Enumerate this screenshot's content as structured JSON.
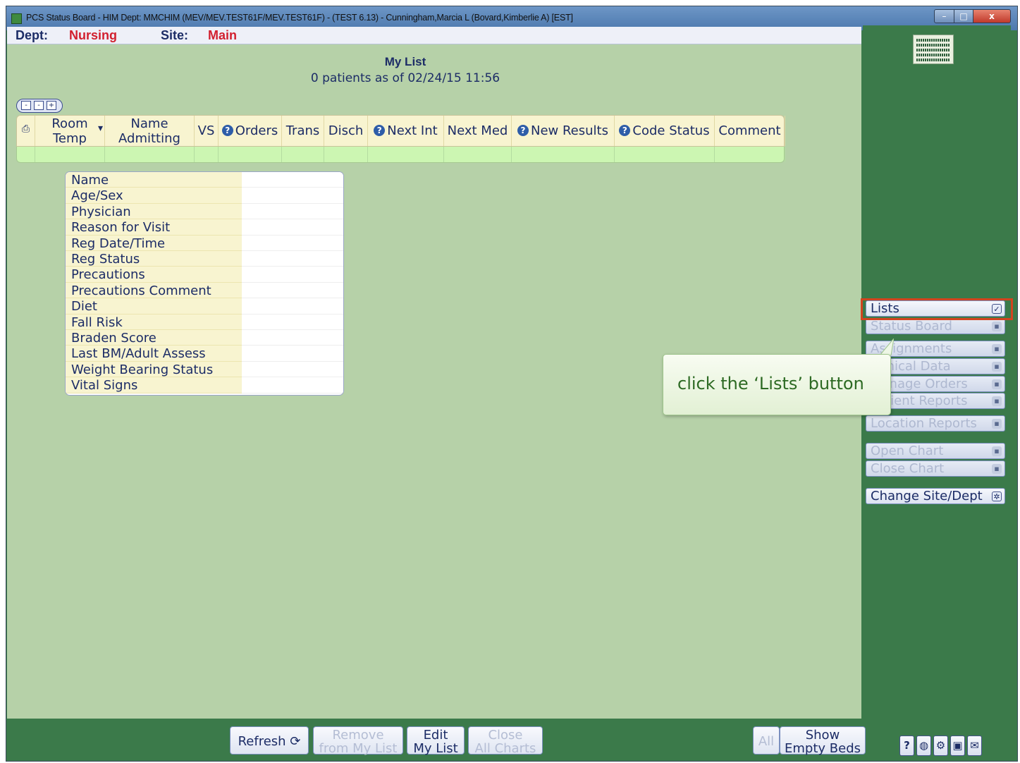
{
  "window": {
    "title": "PCS Status Board - HIM Dept: MMCHIM (MEV/MEV.TEST61F/MEV.TEST61F) - (TEST 6.13) - Cunningham,Marcia L (Bovard,Kimberlie A) [EST]",
    "controls": {
      "minimize": "–",
      "maximize": "□",
      "close": "x"
    }
  },
  "deptbar": {
    "dept_label": "Dept:",
    "dept_value": "Nursing",
    "site_label": "Site:",
    "site_value": "Main"
  },
  "list": {
    "title": "My List",
    "count_text": "0 patients as of 02/24/15 11:56"
  },
  "column_toggle": {
    "collapse": "-",
    "expand": "+"
  },
  "columns": [
    {
      "key": "room",
      "line1": "Room",
      "line2": "Temp",
      "help": false
    },
    {
      "key": "name",
      "line1": "Name",
      "line2": "Admitting",
      "help": false
    },
    {
      "key": "vs",
      "label": "VS",
      "help": false
    },
    {
      "key": "orders",
      "label": "Orders",
      "help": true
    },
    {
      "key": "trans",
      "label": "Trans",
      "help": false
    },
    {
      "key": "disch",
      "label": "Disch",
      "help": false
    },
    {
      "key": "next_int",
      "label": "Next Int",
      "help": true
    },
    {
      "key": "next_med",
      "label": "Next Med",
      "help": false
    },
    {
      "key": "new_results",
      "label": "New Results",
      "help": true
    },
    {
      "key": "code_status",
      "label": "Code Status",
      "help": true
    },
    {
      "key": "comment",
      "label": "Comment",
      "help": false
    }
  ],
  "detail_fields": [
    {
      "label": "Name",
      "value": ""
    },
    {
      "label": "Age/Sex",
      "value": ""
    },
    {
      "label": "Physician",
      "value": ""
    },
    {
      "label": "Reason for Visit",
      "value": ""
    },
    {
      "label": "Reg Date/Time",
      "value": ""
    },
    {
      "label": "Reg Status",
      "value": ""
    },
    {
      "label": "Precautions",
      "value": ""
    },
    {
      "label": "Precautions Comment",
      "value": ""
    },
    {
      "label": "Diet",
      "value": ""
    },
    {
      "label": "Fall Risk",
      "value": ""
    },
    {
      "label": "Braden Score",
      "value": ""
    },
    {
      "label": "Last BM/Adult Assess",
      "value": ""
    },
    {
      "label": "Weight Bearing Status",
      "value": ""
    },
    {
      "label": "Vital Signs",
      "value": ""
    }
  ],
  "sidebar": {
    "buttons": [
      {
        "label": "Lists",
        "enabled": true,
        "icon": "checklist-icon"
      },
      {
        "label": "Status Board",
        "enabled": false,
        "icon": "board-icon"
      },
      {
        "label": "Assignments",
        "enabled": false,
        "icon": "pencil-icon"
      },
      {
        "label": "Clinical Data",
        "enabled": false,
        "icon": "data-icon"
      },
      {
        "label": "Manage Orders",
        "enabled": false,
        "icon": "orders-icon"
      },
      {
        "label": "Patient Reports",
        "enabled": false,
        "icon": "report-icon"
      },
      {
        "label": "Location Reports",
        "enabled": false,
        "icon": "location-icon"
      },
      {
        "label": "Open Chart",
        "enabled": false,
        "icon": "open-chart-icon"
      },
      {
        "label": "Close Chart",
        "enabled": false,
        "icon": "close-chart-icon"
      },
      {
        "label": "Change Site/Dept",
        "enabled": true,
        "icon": "gear-icon"
      }
    ]
  },
  "callout": {
    "text": "click the ‘Lists’ button"
  },
  "bottombar": {
    "refresh": "Refresh",
    "remove_line1": "Remove",
    "remove_line2": "from My List",
    "edit_line1": "Edit",
    "edit_line2": "My List",
    "close_line1": "Close",
    "close_line2": "All Charts",
    "all": "All",
    "show_line1": "Show",
    "show_line2": "Empty Beds"
  },
  "tray_icons": [
    "help-icon",
    "globe-icon",
    "settings-icon",
    "lock-icon",
    "mail-icon"
  ],
  "colors": {
    "panel_green": "#b6d1a8",
    "frame_green": "#3b7a4a",
    "header_yellow": "#f8f4d0",
    "row_green": "#ccf6b2",
    "highlight_red": "#d2441f",
    "accent_red_text": "#d2202f",
    "navy_text": "#1c2c66"
  }
}
